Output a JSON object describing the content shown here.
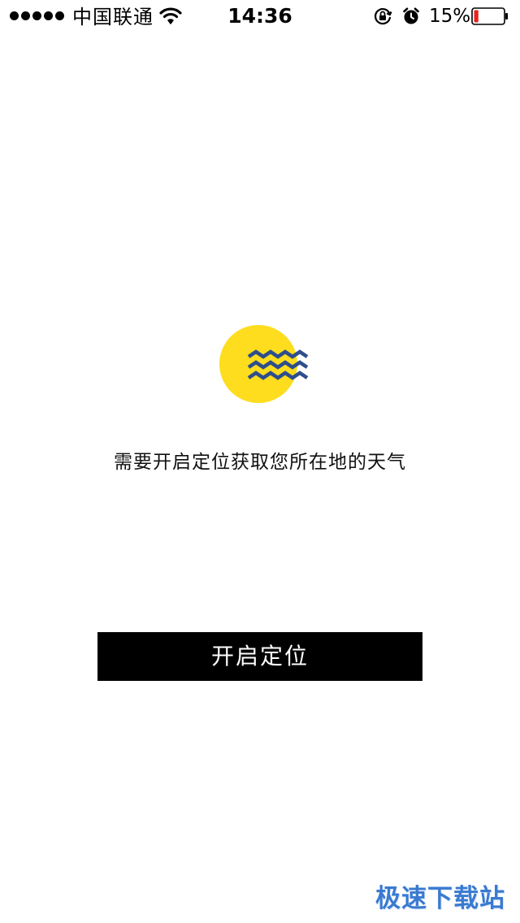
{
  "status_bar": {
    "carrier": "中国联通",
    "time": "14:36",
    "battery_percent": "15%",
    "battery_level": 0.15,
    "icons": [
      "signal-dots-icon",
      "wifi-icon",
      "rotation-lock-icon",
      "alarm-icon",
      "battery-icon"
    ]
  },
  "main": {
    "logo_icon": "weather-sun-waves-icon",
    "message": "需要开启定位获取您所在地的天气",
    "enable_button_label": "开启定位"
  },
  "watermark": {
    "text": "极速下载站"
  },
  "colors": {
    "background": "#ffffff",
    "button_bg": "#000000",
    "button_text": "#ffffff",
    "logo_sun": "#fddd1e",
    "logo_waves": "#2e4e8c",
    "battery_low": "#e8231e",
    "watermark": "#3a7ad1"
  }
}
